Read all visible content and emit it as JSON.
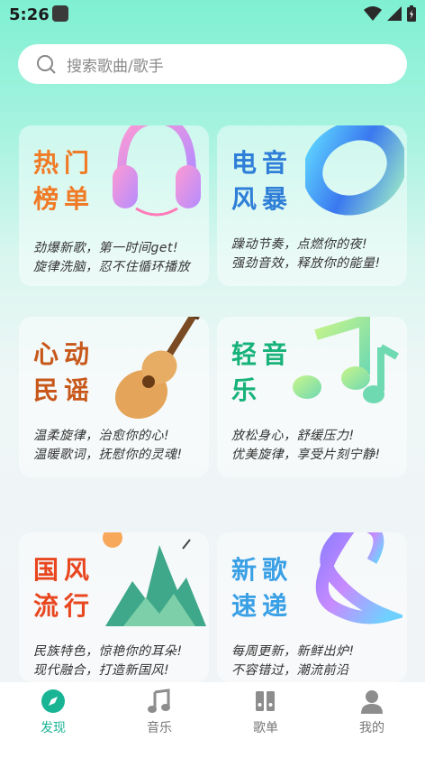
{
  "status_bar": {
    "time": "5:26"
  },
  "search": {
    "placeholder": "搜索歌曲/歌手"
  },
  "cards": [
    {
      "title": "热门榜单",
      "line1": "劲爆新歌，第一时间get!",
      "line2": "旋律洗脑，忍不住循环播放",
      "color": "#f07b27",
      "art": "headphones-icon"
    },
    {
      "title": "电音风暴",
      "line1": "躁动节奏，点燃你的夜!",
      "line2": "强劲音效，释放你的能量!",
      "color": "#2f7fd8",
      "art": "torus-icon"
    },
    {
      "title": "心动民谣",
      "line1": "温柔旋律，治愈你的心!",
      "line2": "温暖歌词，抚慰你的灵魂!",
      "color": "#c8581a",
      "art": "guitar-icon"
    },
    {
      "title": "轻音乐",
      "line1": "放松身心，舒缓压力!",
      "line2": "优美旋律，享受片刻宁静!",
      "color": "#17b27a",
      "art": "music-note-icon"
    },
    {
      "title": "国风流行",
      "line1": "民族特色，惊艳你的耳朵!",
      "line2": "现代融合，打造新国风!",
      "color": "#e8461e",
      "art": "mountain-icon"
    },
    {
      "title": "新歌速递",
      "line1": "每周更新，新鲜出炉!",
      "line2": "不容错过，潮流前沿",
      "color": "#3aa0e6",
      "art": "ribbon-icon"
    }
  ],
  "nav": [
    {
      "label": "发现",
      "icon": "compass-icon",
      "active": true
    },
    {
      "label": "音乐",
      "icon": "music-icon",
      "active": false
    },
    {
      "label": "歌单",
      "icon": "playlist-icon",
      "active": false
    },
    {
      "label": "我的",
      "icon": "profile-icon",
      "active": false
    }
  ],
  "colors": {
    "accent": "#19b494",
    "inactive": "#8d8d8d"
  }
}
